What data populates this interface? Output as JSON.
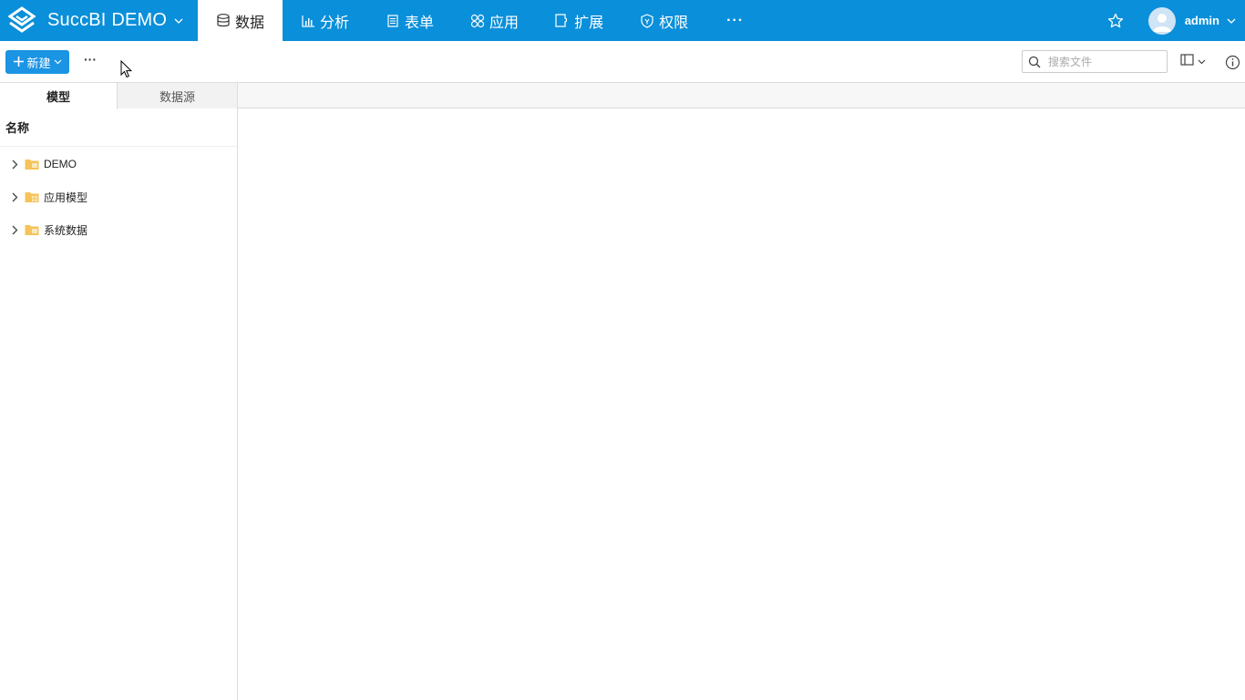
{
  "brand": {
    "title": "SuccBI DEMO"
  },
  "nav": {
    "items": [
      {
        "label": "数据",
        "icon": "database-icon",
        "active": true
      },
      {
        "label": "分析",
        "icon": "bar-chart-icon",
        "active": false
      },
      {
        "label": "表单",
        "icon": "form-icon",
        "active": false
      },
      {
        "label": "应用",
        "icon": "apps-icon",
        "active": false
      },
      {
        "label": "扩展",
        "icon": "extension-icon",
        "active": false
      },
      {
        "label": "权限",
        "icon": "shield-icon",
        "active": false
      }
    ],
    "more_label": "···"
  },
  "user": {
    "name": "admin"
  },
  "toolbar": {
    "new_label": "新建",
    "more_label": "···",
    "search_placeholder": "搜索文件"
  },
  "left_panel": {
    "tabs": [
      {
        "label": "模型",
        "active": true
      },
      {
        "label": "数据源",
        "active": false
      }
    ],
    "column_header": "名称",
    "tree": [
      {
        "label": "DEMO"
      },
      {
        "label": "应用模型"
      },
      {
        "label": "系统数据"
      }
    ]
  },
  "colors": {
    "primary": "#0a8fda",
    "button": "#1b94e4",
    "folder": "#f5c35a"
  }
}
